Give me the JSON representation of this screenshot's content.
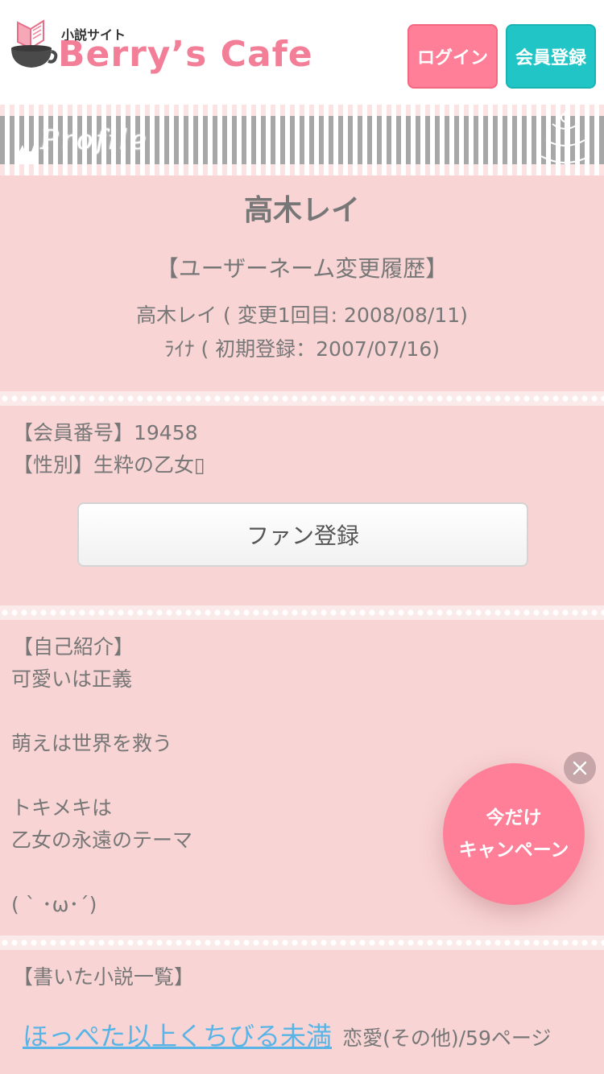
{
  "header": {
    "logo_small": "小説サイト",
    "logo_big": "Berry’s Cafe",
    "login_label": "ログイン",
    "register_label": "会員登録"
  },
  "banner": {
    "text": "Profile"
  },
  "profile": {
    "name": "高木レイ",
    "history_title": "【ユーザーネーム変更履歴】",
    "history": [
      "高木レイ ( 変更1回目: 2008/08/11)",
      "ﾗｲﾅ ( 初期登録：2007/07/16)"
    ]
  },
  "member": {
    "number_line": "【会員番号】19458",
    "gender_line": "【性別】生粋の乙女▯",
    "fan_button": "ファン登録"
  },
  "intro": {
    "heading": "【自己紹介】",
    "lines": [
      "可愛いは正義",
      "",
      "萌えは世界を救う",
      "",
      "トキメキは",
      "乙女の永遠のテーマ",
      "",
      "( ` ･ω･´)"
    ]
  },
  "novels": {
    "heading": "【書いた小説一覧】",
    "items": [
      {
        "title": "ほっぺた以上くちびる未満",
        "meta": "恋愛(その他)/59ページ"
      }
    ]
  },
  "campaign": {
    "line1": "今だけ",
    "line2": "キャンペーン"
  },
  "colors": {
    "page_bg": "#f8d4d4",
    "brand_pink": "#f27f97",
    "login_bg": "#ff7f98",
    "register_bg": "#22c5c5",
    "link": "#58b4e6"
  },
  "icons": [
    "book-cup-logo-icon",
    "close-icon",
    "lace-ornament-icon",
    "cat-silhouette-icon"
  ]
}
